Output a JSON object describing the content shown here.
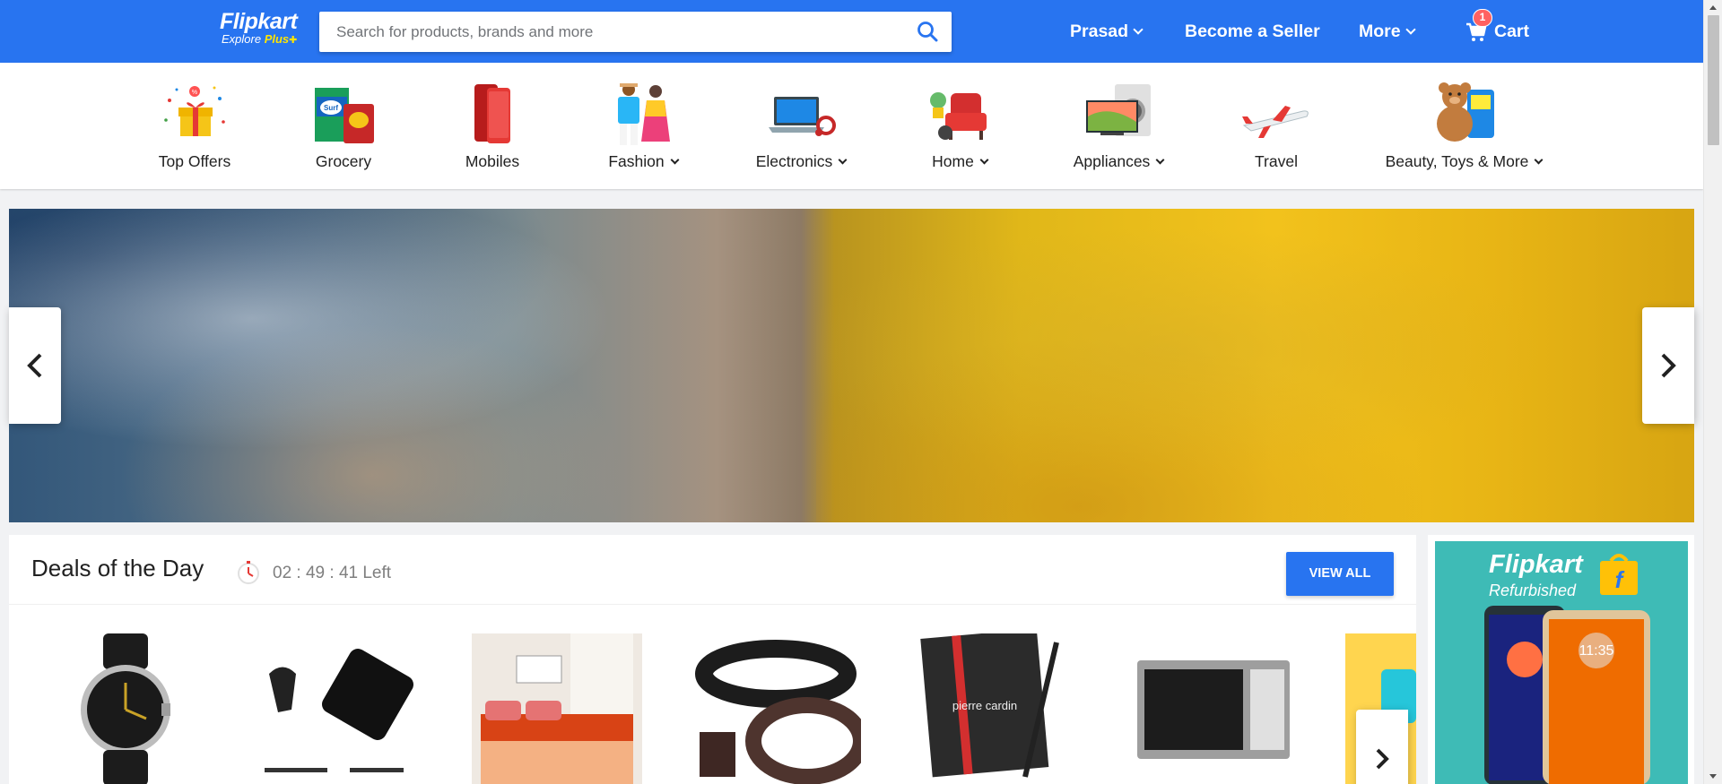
{
  "header": {
    "logo_text": "Flipkart",
    "logo_subtitle": "Explore",
    "logo_plus": "Plus",
    "search_placeholder": "Search for products, brands and more",
    "user_label": "Prasad",
    "seller_label": "Become a Seller",
    "more_label": "More",
    "cart_label": "Cart",
    "cart_count": "1",
    "icons": [
      "search-icon",
      "chevron-down-icon",
      "cart-icon"
    ],
    "colors": {
      "brand": "#2874f0",
      "logo_accent": "#ffe500",
      "badge": "#ff6161"
    }
  },
  "categories": [
    {
      "label": "Top Offers",
      "has_dropdown": false,
      "icon": "gift-icon"
    },
    {
      "label": "Grocery",
      "has_dropdown": false,
      "icon": "grocery-icon"
    },
    {
      "label": "Mobiles",
      "has_dropdown": false,
      "icon": "mobile-icon"
    },
    {
      "label": "Fashion",
      "has_dropdown": true,
      "icon": "fashion-icon"
    },
    {
      "label": "Electronics",
      "has_dropdown": true,
      "icon": "laptop-icon"
    },
    {
      "label": "Home",
      "has_dropdown": true,
      "icon": "home-icon"
    },
    {
      "label": "Appliances",
      "has_dropdown": true,
      "icon": "tv-icon"
    },
    {
      "label": "Travel",
      "has_dropdown": false,
      "icon": "airplane-icon"
    },
    {
      "label": "Beauty, Toys & More",
      "has_dropdown": true,
      "icon": "toy-icon"
    }
  ],
  "banner": {
    "icons": [
      "chevron-left-icon",
      "chevron-right-icon"
    ]
  },
  "deals": {
    "title": "Deals of the Day",
    "timer": "02 : 49 : 41 Left",
    "view_all_label": "VIEW ALL",
    "products": [
      {
        "name": "watch"
      },
      {
        "name": "bluetooth-headset-charger"
      },
      {
        "name": "bedsheet"
      },
      {
        "name": "belts"
      },
      {
        "name": "pierre-cardin-gift-set"
      },
      {
        "name": "microwave-oven"
      },
      {
        "name": "partial-product"
      }
    ]
  },
  "side_ad": {
    "title": "Flipkart",
    "subtitle": "Refurbished",
    "phone_time": "11:35"
  }
}
